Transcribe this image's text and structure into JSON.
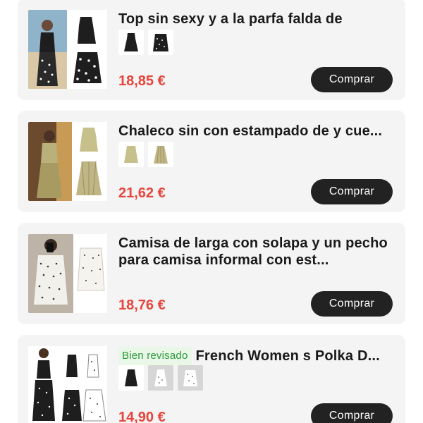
{
  "products": [
    {
      "title": "Top sin sexy y a la parfa falda de",
      "price": "18,85 €",
      "buy_label": "Comprar",
      "image": "halter-top-and-polka-dot-skirt-photo",
      "variants": [
        "black-halter-top",
        "black-polka-dot-skirt"
      ]
    },
    {
      "title": "Chaleco sin con estampado de y cue...",
      "price": "21,62 €",
      "buy_label": "Comprar",
      "image": "beige-printed-vest-and-skirt-photo",
      "variants": [
        "beige-printed-vest",
        "beige-printed-skirt"
      ]
    },
    {
      "title": "Camisa de larga con solapa y un pecho para camisa informal con est...",
      "price": "18,76 €",
      "buy_label": "Comprar",
      "image": "white-polka-dot-shirt-photo",
      "variants": []
    },
    {
      "badge": "Bien revisado",
      "title": "French Women s Polka D...",
      "price": "14,90 €",
      "buy_label": "Comprar",
      "image": "polka-dot-two-piece-set-photo",
      "variants": [
        "black-halter-top",
        "white-polka-dot-halter-top",
        "white-polka-dot-skirt"
      ]
    }
  ],
  "colors": {
    "card_bg": "#f4f4f4",
    "price": "#e8453c",
    "button_bg": "#222222",
    "badge_text": "#2f9a3a",
    "badge_bg": "#e8f7e7"
  }
}
